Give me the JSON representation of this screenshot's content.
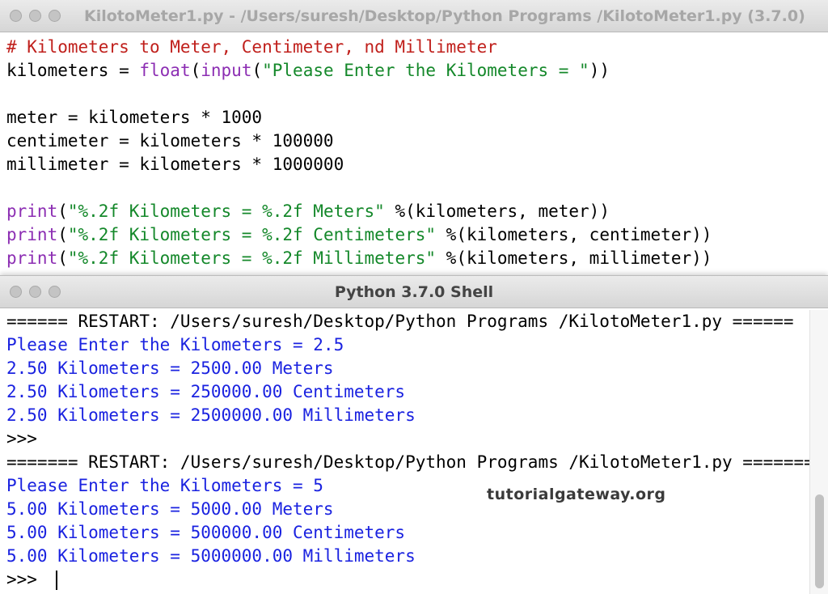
{
  "editor": {
    "title": "KilotoMeter1.py - /Users/suresh/Desktop/Python Programs /KilotoMeter1.py (3.7.0)",
    "lines": [
      "# Kilometers to Meter, Centimeter, nd Millimeter",
      "kilometers = ",
      "float",
      "(",
      "input",
      "(",
      "\"Please Enter the Kilometers = \"",
      "))",
      "meter = kilometers * 1000",
      "centimeter = kilometers * 100000",
      "millimeter = kilometers * 1000000",
      "print",
      "(",
      "\"%.2f Kilometers = %.2f Meters\"",
      " %(kilometers, meter))",
      "print",
      "(",
      "\"%.2f Kilometers = %.2f Centimeters\"",
      " %(kilometers, centimeter))",
      "print",
      "(",
      "\"%.2f Kilometers = %.2f Millimeters\"",
      " %(kilometers, millimeter))"
    ]
  },
  "shell": {
    "title": "Python 3.7.0 Shell",
    "restart1": "====== RESTART: /Users/suresh/Desktop/Python Programs /KilotoMeter1.py ======",
    "run1": [
      "Please Enter the Kilometers = 2.5",
      "2.50 Kilometers = 2500.00 Meters",
      "2.50 Kilometers = 250000.00 Centimeters",
      "2.50 Kilometers = 2500000.00 Millimeters"
    ],
    "prompt": ">>>",
    "restart2": "======= RESTART: /Users/suresh/Desktop/Python Programs /KilotoMeter1.py =======",
    "run2": [
      "Please Enter the Kilometers = 5",
      "5.00 Kilometers = 5000.00 Meters",
      "5.00 Kilometers = 500000.00 Centimeters",
      "5.00 Kilometers = 5000000.00 Millimeters"
    ],
    "prompt_final": ">>> "
  },
  "watermark": "tutorialgateway.org",
  "colors": {
    "comment": "#c0201c",
    "builtin": "#8c2eb3",
    "string": "#14882a",
    "output": "#1a22e0"
  }
}
